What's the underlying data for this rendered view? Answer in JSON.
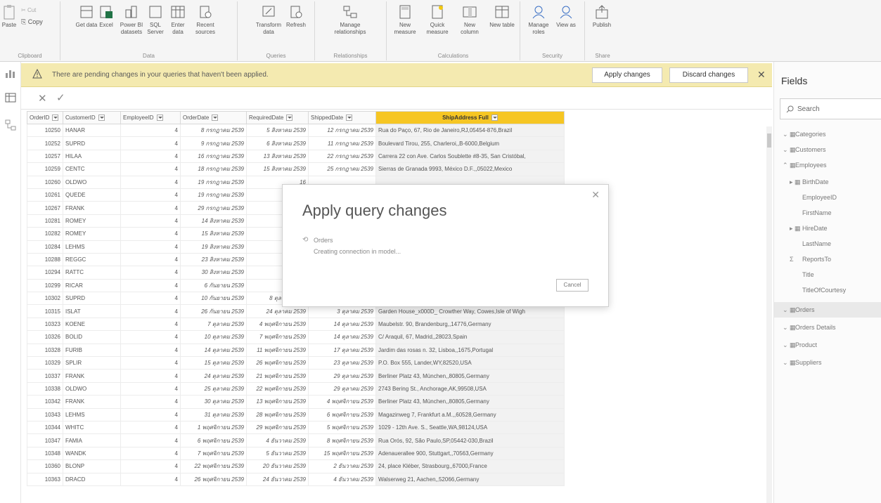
{
  "ribbon": {
    "clipboard": {
      "paste": "Paste",
      "cut": "Cut",
      "copy": "Copy",
      "group": "Clipboard"
    },
    "data": {
      "get_data": "Get data",
      "excel": "Excel",
      "powerbi": "Power BI datasets",
      "sql": "SQL Server",
      "enter": "Enter data",
      "recent": "Recent sources",
      "group": "Data"
    },
    "queries": {
      "transform": "Transform data",
      "refresh": "Refresh",
      "group": "Queries"
    },
    "relationships": {
      "manage": "Manage relationships",
      "group": "Relationships"
    },
    "calculations": {
      "new_measure": "New measure",
      "quick_measure": "Quick measure",
      "new_column": "New column",
      "new_table": "New table",
      "group": "Calculations"
    },
    "security": {
      "manage_roles": "Manage roles",
      "view_as": "View as",
      "group": "Security"
    },
    "share": {
      "publish": "Publish",
      "group": "Share"
    }
  },
  "warning": {
    "message": "There are pending changes in your queries that haven't been applied.",
    "apply": "Apply changes",
    "discard": "Discard changes"
  },
  "grid": {
    "columns": [
      "OrderID",
      "CustomerID",
      "EmployeeID",
      "OrderDate",
      "RequiredDate",
      "ShippedDate",
      "ShipAddress Full"
    ],
    "rows": [
      [
        "10250",
        "HANAR",
        "4",
        "8 กรกฎาคม 2539",
        "5 สิงหาคม 2539",
        "12 กรกฎาคม 2539",
        "Rua do Paço, 67, Rio de Janeiro,RJ,05454-876,Brazil"
      ],
      [
        "10252",
        "SUPRD",
        "4",
        "9 กรกฎาคม 2539",
        "6 สิงหาคม 2539",
        "11 กรกฎาคม 2539",
        "Boulevard Tirou, 255, Charleroi,,B-6000,Belgium"
      ],
      [
        "10257",
        "HILAA",
        "4",
        "16 กรกฎาคม 2539",
        "13 สิงหาคม 2539",
        "22 กรกฎาคม 2539",
        "Carrera 22 con Ave. Carlos Soublette #8-35, San Cristóbal,"
      ],
      [
        "10259",
        "CENTC",
        "4",
        "18 กรกฎาคม 2539",
        "15 สิงหาคม 2539",
        "25 กรกฎาคม 2539",
        "Sierras de Granada 9993, México D.F.,,05022,Mexico"
      ],
      [
        "10260",
        "OLDWO",
        "4",
        "19 กรกฎาคม 2539",
        "16",
        "",
        ""
      ],
      [
        "10261",
        "QUEDE",
        "4",
        "19 กรกฎาคม 2539",
        "16",
        "",
        ""
      ],
      [
        "10267",
        "FRANK",
        "4",
        "29 กรกฎาคม 2539",
        "26",
        "",
        ""
      ],
      [
        "10281",
        "ROMEY",
        "4",
        "14 สิงหาคม 2539",
        "28",
        "",
        ""
      ],
      [
        "10282",
        "ROMEY",
        "4",
        "15 สิงหาคม 2539",
        "12",
        "",
        ""
      ],
      [
        "10284",
        "LEHMS",
        "4",
        "19 สิงหาคม 2539",
        "16",
        "",
        ""
      ],
      [
        "10288",
        "REGGC",
        "4",
        "23 สิงหาคม 2539",
        "20",
        "",
        ""
      ],
      [
        "10294",
        "RATTC",
        "4",
        "30 สิงหาคม 2539",
        "27",
        "",
        ""
      ],
      [
        "10299",
        "RICAR",
        "4",
        "6 กันยายน 2539",
        "",
        "",
        ""
      ],
      [
        "10302",
        "SUPRD",
        "4",
        "10 กันยายน 2539",
        "8 ตุลาคม 2539",
        "9 ตุลาคม 2539",
        "Boulevard Tirou, 255, Charleroi,,B-6000,Belgium"
      ],
      [
        "10315",
        "ISLAT",
        "4",
        "26 กันยายน 2539",
        "24 ตุลาคม 2539",
        "3 ตุลาคม 2539",
        "Garden House_x000D_ Crowther Way, Cowes,Isle of Wigh"
      ],
      [
        "10323",
        "KOENE",
        "4",
        "7 ตุลาคม 2539",
        "4 พฤศจิกายน 2539",
        "14 ตุลาคม 2539",
        "Maubelstr. 90, Brandenburg,,14776,Germany"
      ],
      [
        "10326",
        "BOLID",
        "4",
        "10 ตุลาคม 2539",
        "7 พฤศจิกายน 2539",
        "14 ตุลาคม 2539",
        "C/ Araquil, 67, Madrid,,28023,Spain"
      ],
      [
        "10328",
        "FURIB",
        "4",
        "14 ตุลาคม 2539",
        "11 พฤศจิกายน 2539",
        "17 ตุลาคม 2539",
        "Jardim das rosas n. 32, Lisboa,,1675,Portugal"
      ],
      [
        "10329",
        "SPLIR",
        "4",
        "15 ตุลาคม 2539",
        "26 พฤศจิกายน 2539",
        "23 ตุลาคม 2539",
        "P.O. Box 555, Lander,WY,82520,USA"
      ],
      [
        "10337",
        "FRANK",
        "4",
        "24 ตุลาคม 2539",
        "21 พฤศจิกายน 2539",
        "29 ตุลาคม 2539",
        "Berliner Platz 43, München,,80805,Germany"
      ],
      [
        "10338",
        "OLDWO",
        "4",
        "25 ตุลาคม 2539",
        "22 พฤศจิกายน 2539",
        "29 ตุลาคม 2539",
        "2743 Bering St., Anchorage,AK,99508,USA"
      ],
      [
        "10342",
        "FRANK",
        "4",
        "30 ตุลาคม 2539",
        "13 พฤศจิกายน 2539",
        "4 พฤศจิกายน 2539",
        "Berliner Platz 43, München,,80805,Germany"
      ],
      [
        "10343",
        "LEHMS",
        "4",
        "31 ตุลาคม 2539",
        "28 พฤศจิกายน 2539",
        "6 พฤศจิกายน 2539",
        "Magazinweg 7, Frankfurt a.M.,,60528,Germany"
      ],
      [
        "10344",
        "WHITC",
        "4",
        "1 พฤศจิกายน 2539",
        "29 พฤศจิกายน 2539",
        "5 พฤศจิกายน 2539",
        "1029 - 12th Ave. S., Seattle,WA,98124,USA"
      ],
      [
        "10347",
        "FAMIA",
        "4",
        "6 พฤศจิกายน 2539",
        "4 ธันวาคม 2539",
        "8 พฤศจิกายน 2539",
        "Rua Orós, 92, São Paulo,SP,05442-030,Brazil"
      ],
      [
        "10348",
        "WANDK",
        "4",
        "7 พฤศจิกายน 2539",
        "5 ธันวาคม 2539",
        "15 พฤศจิกายน 2539",
        "Adenauerallee 900, Stuttgart,,70563,Germany"
      ],
      [
        "10360",
        "BLONP",
        "4",
        "22 พฤศจิกายน 2539",
        "20 ธันวาคม 2539",
        "2 ธันวาคม 2539",
        "24, place Kléber, Strasbourg,,67000,France"
      ],
      [
        "10363",
        "DRACD",
        "4",
        "26 พฤศจิกายน 2539",
        "24 ธันวาคม 2539",
        "4 ธันวาคม 2539",
        "Walserweg 21, Aachen,,52066,Germany"
      ]
    ]
  },
  "dialog": {
    "title": "Apply query changes",
    "query": "Orders",
    "status": "Creating connection in model...",
    "cancel": "Cancel"
  },
  "fields": {
    "title": "Fields",
    "search_placeholder": "Search",
    "tables": [
      {
        "name": "Categories",
        "expanded": false
      },
      {
        "name": "Customers",
        "expanded": false
      },
      {
        "name": "Employees",
        "expanded": true
      }
    ],
    "employee_fields": [
      "BirthDate",
      "EmployeeID",
      "FirstName",
      "HireDate",
      "LastName",
      "ReportsTo",
      "Title",
      "TitleOfCourtesy"
    ],
    "tables_after": [
      "Orders",
      "Orders Details",
      "Product",
      "Suppliers"
    ]
  },
  "colors": {
    "accent": "#f6c623",
    "warning_bg": "#f4eab0"
  }
}
